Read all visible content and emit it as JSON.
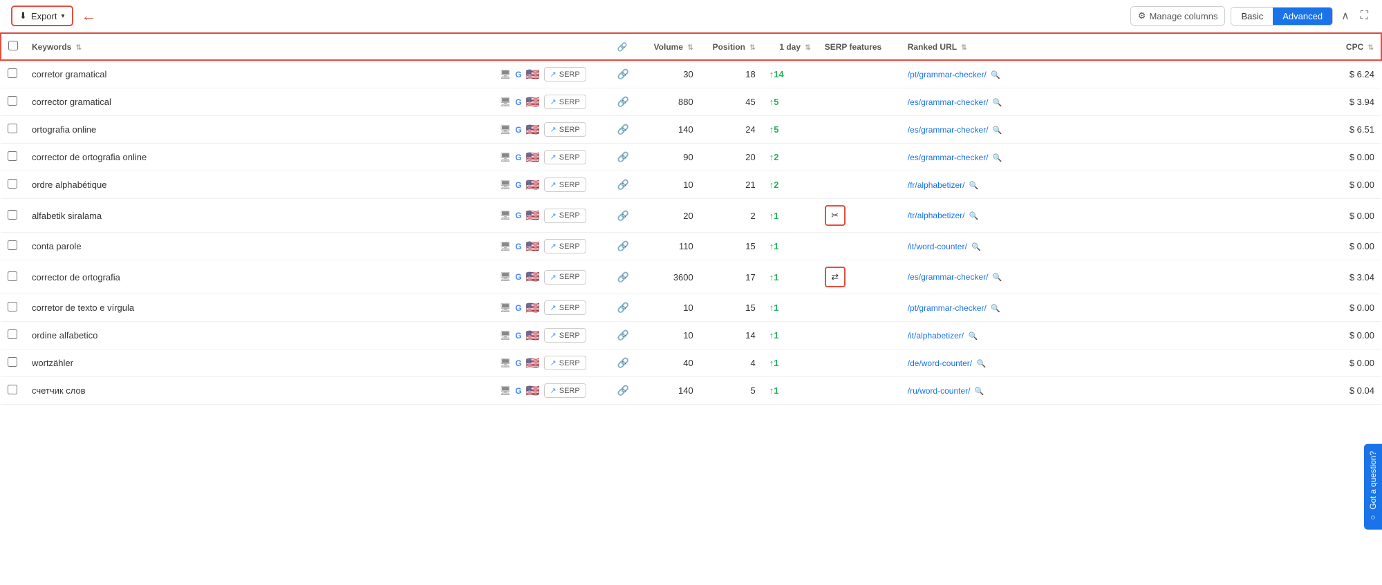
{
  "toolbar": {
    "export_label": "Export",
    "manage_columns_label": "Manage columns",
    "view_basic_label": "Basic",
    "view_advanced_label": "Advanced",
    "active_view": "Advanced"
  },
  "table": {
    "columns": {
      "keywords": "Keywords",
      "volume": "Volume",
      "position": "Position",
      "one_day": "1 day",
      "serp_features": "SERP features",
      "ranked_url": "Ranked URL",
      "cpc": "CPC"
    },
    "rows": [
      {
        "keyword": "corretor gramatical",
        "volume": "30",
        "position": "18",
        "one_day": "↑14",
        "one_day_value": 14,
        "serp_feature": "",
        "serp_icon": "scissors",
        "ranked_url": "/pt/grammar-checker/",
        "cpc": "$ 6.24",
        "has_serp_box": false
      },
      {
        "keyword": "corrector gramatical",
        "volume": "880",
        "position": "45",
        "one_day": "↑5",
        "one_day_value": 5,
        "serp_feature": "",
        "serp_icon": "",
        "ranked_url": "/es/grammar-checker/",
        "cpc": "$ 3.94",
        "has_serp_box": false
      },
      {
        "keyword": "ortografia online",
        "volume": "140",
        "position": "24",
        "one_day": "↑5",
        "one_day_value": 5,
        "serp_feature": "",
        "serp_icon": "",
        "ranked_url": "/es/grammar-checker/",
        "cpc": "$ 6.51",
        "has_serp_box": false
      },
      {
        "keyword": "corrector de ortografia online",
        "volume": "90",
        "position": "20",
        "one_day": "↑2",
        "one_day_value": 2,
        "serp_feature": "",
        "serp_icon": "",
        "ranked_url": "/es/grammar-checker/",
        "cpc": "$ 0.00",
        "has_serp_box": false
      },
      {
        "keyword": "ordre alphabétique",
        "volume": "10",
        "position": "21",
        "one_day": "↑2",
        "one_day_value": 2,
        "serp_feature": "",
        "serp_icon": "",
        "ranked_url": "/fr/alphabetizer/",
        "cpc": "$ 0.00",
        "has_serp_box": false
      },
      {
        "keyword": "alfabetik siralama",
        "volume": "20",
        "position": "2",
        "one_day": "↑1",
        "one_day_value": 1,
        "serp_feature": "",
        "serp_icon": "scissors",
        "ranked_url": "/tr/alphabetizer/",
        "cpc": "$ 0.00",
        "has_serp_box": true,
        "serp_box_type": "scissors"
      },
      {
        "keyword": "conta parole",
        "volume": "110",
        "position": "15",
        "one_day": "↑1",
        "one_day_value": 1,
        "serp_feature": "",
        "serp_icon": "",
        "ranked_url": "/it/word-counter/",
        "cpc": "$ 0.00",
        "has_serp_box": false
      },
      {
        "keyword": "corrector de ortografia",
        "volume": "3600",
        "position": "17",
        "one_day": "↑1",
        "one_day_value": 1,
        "serp_feature": "",
        "serp_icon": "arrows",
        "ranked_url": "/es/grammar-checker/",
        "cpc": "$ 3.04",
        "has_serp_box": true,
        "serp_box_type": "arrows"
      },
      {
        "keyword": "corretor de texto e vírgula",
        "volume": "10",
        "position": "15",
        "one_day": "↑1",
        "one_day_value": 1,
        "serp_feature": "",
        "serp_icon": "",
        "ranked_url": "/pt/grammar-checker/",
        "cpc": "$ 0.00",
        "has_serp_box": false
      },
      {
        "keyword": "ordine alfabetico",
        "volume": "10",
        "position": "14",
        "one_day": "↑1",
        "one_day_value": 1,
        "serp_feature": "",
        "serp_icon": "",
        "ranked_url": "/it/alphabetizer/",
        "cpc": "$ 0.00",
        "has_serp_box": false
      },
      {
        "keyword": "wortzähler",
        "volume": "40",
        "position": "4",
        "one_day": "↑1",
        "one_day_value": 1,
        "serp_feature": "",
        "serp_icon": "",
        "ranked_url": "/de/word-counter/",
        "cpc": "$ 0.00",
        "has_serp_box": false
      },
      {
        "keyword": "счетчик слов",
        "volume": "140",
        "position": "5",
        "one_day": "↑1",
        "one_day_value": 1,
        "serp_feature": "",
        "serp_icon": "",
        "ranked_url": "/ru/word-counter/",
        "cpc": "$ 0.04",
        "has_serp_box": false
      }
    ]
  },
  "got_question": "Got a question?"
}
